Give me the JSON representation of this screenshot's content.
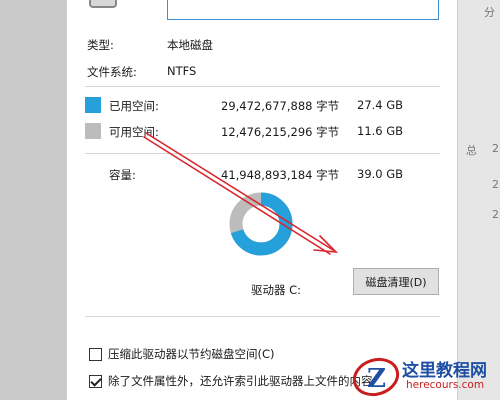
{
  "general": {
    "type_label": "类型:",
    "type_value": "本地磁盘",
    "fs_label": "文件系统:",
    "fs_value": "NTFS"
  },
  "space": {
    "used": {
      "label": "已用空间:",
      "bytes": "29,472,677,888 字节",
      "size": "27.4 GB",
      "color": "#26a0da"
    },
    "free": {
      "label": "可用空间:",
      "bytes": "12,476,215,296 字节",
      "size": "11.6 GB",
      "color": "#bcbcbc"
    },
    "capacity": {
      "label": "容量:",
      "bytes": "41,948,893,184 字节",
      "size": "39.0 GB"
    },
    "used_fraction": 0.702
  },
  "drive_label": "驱动器 C:",
  "cleanup_button": "磁盘清理(D)",
  "options": {
    "compress": {
      "label": "压缩此驱动器以节约磁盘空间(C)",
      "checked": false
    },
    "index": {
      "label": "除了文件属性外，还允许索引此驱动器上文件的内容",
      "checked": true
    }
  },
  "watermark": {
    "main": "这里教程网",
    "sub": "herecours.com",
    "logo_letter": "Z"
  },
  "right_glyphs": [
    "总",
    "2",
    "2",
    "2",
    "分"
  ]
}
